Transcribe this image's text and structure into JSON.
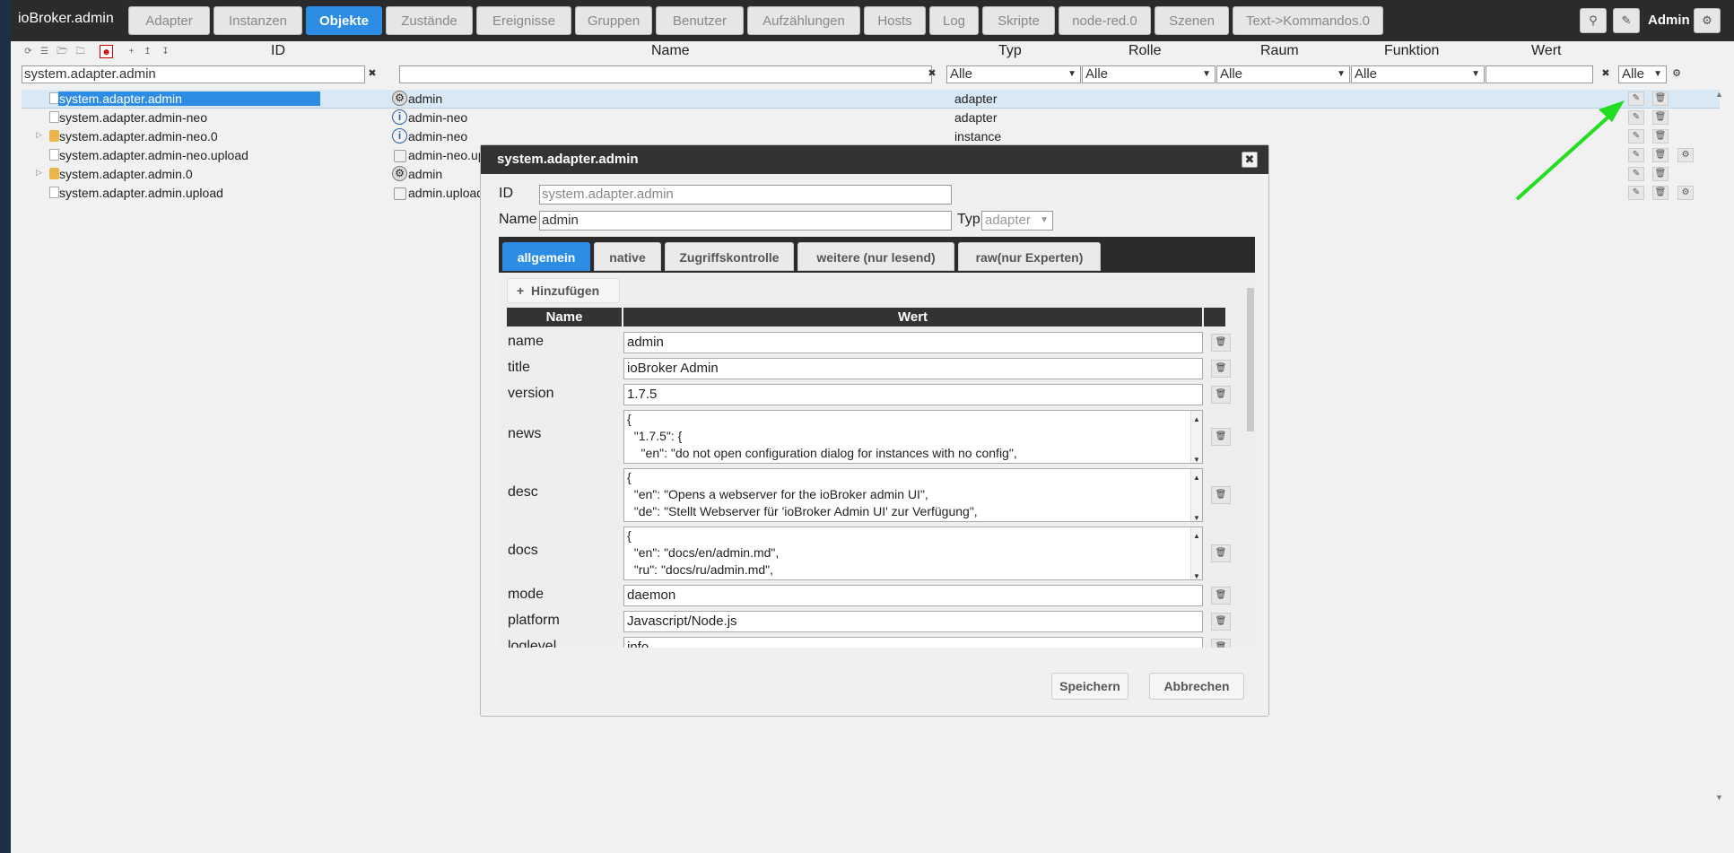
{
  "app": {
    "brand": "ioBroker.admin",
    "tabs": [
      "Adapter",
      "Instanzen",
      "Objekte",
      "Zustände",
      "Ereignisse",
      "Gruppen",
      "Benutzer",
      "Aufzählungen",
      "Hosts",
      "Log",
      "Skripte",
      "node-red.0",
      "Szenen",
      "Text->Kommandos.0"
    ],
    "active_tab": "Objekte",
    "user": "Admin",
    "icons": {
      "search": "search-icon",
      "edit": "pencil-icon",
      "settings": "gear-icon"
    }
  },
  "grid": {
    "headers": {
      "id": "ID",
      "name": "Name",
      "type": "Typ",
      "role": "Rolle",
      "room": "Raum",
      "function": "Funktion",
      "value": "Wert"
    },
    "filters": {
      "id": "system.adapter.admin",
      "name": "",
      "type": "Alle",
      "role": "Alle",
      "room": "Alle",
      "function": "Alle",
      "value": "",
      "value_select": "Alle"
    },
    "rows": [
      {
        "id": "system.adapter.admin",
        "name": "admin",
        "type": "adapter",
        "icon": "gear-icon",
        "selected": true
      },
      {
        "id": "system.adapter.admin-neo",
        "name": "admin-neo",
        "type": "adapter",
        "icon": "info-icon"
      },
      {
        "id": "system.adapter.admin-neo.0",
        "name": "admin-neo",
        "type": "instance",
        "icon": "info-icon",
        "folder": true
      },
      {
        "id": "system.adapter.admin-neo.upload",
        "name": "admin-neo.upl",
        "type": "",
        "icon": "state-icon"
      },
      {
        "id": "system.adapter.admin.0",
        "name": "admin",
        "type": "",
        "icon": "gear-icon",
        "folder": true
      },
      {
        "id": "system.adapter.admin.upload",
        "name": "admin.upload",
        "type": "",
        "icon": "state-icon"
      }
    ]
  },
  "dialog": {
    "title": "system.adapter.admin",
    "id_label": "ID",
    "id_value": "system.adapter.admin",
    "name_label": "Name",
    "name_value": "admin",
    "type_label": "Typ",
    "type_value": "adapter",
    "tabs": [
      "allgemein",
      "native",
      "Zugriffskontrolle",
      "weitere (nur lesend)",
      "raw(nur Experten)"
    ],
    "active_tab": "allgemein",
    "add_button": "Hinzufügen",
    "table_headers": {
      "name": "Name",
      "value": "Wert"
    },
    "properties": [
      {
        "name": "name",
        "value": "admin"
      },
      {
        "name": "title",
        "value": "ioBroker Admin"
      },
      {
        "name": "version",
        "value": "1.7.5"
      },
      {
        "name": "news",
        "value": "{\n  \"1.7.5\": {\n    \"en\": \"do not open configuration dialog for instances with no config\","
      },
      {
        "name": "desc",
        "value": "{\n  \"en\": \"Opens a webserver for the ioBroker admin UI\",\n  \"de\": \"Stellt Webserver für 'ioBroker Admin UI' zur Verfügung\","
      },
      {
        "name": "docs",
        "value": "{\n  \"en\": \"docs/en/admin.md\",\n  \"ru\": \"docs/ru/admin.md\","
      },
      {
        "name": "mode",
        "value": "daemon"
      },
      {
        "name": "platform",
        "value": "Javascript/Node.js"
      },
      {
        "name": "loglevel",
        "value": "info"
      }
    ],
    "save_button": "Speichern",
    "cancel_button": "Abbrechen"
  },
  "annotation": {
    "arrow_color": "#22dd22"
  }
}
